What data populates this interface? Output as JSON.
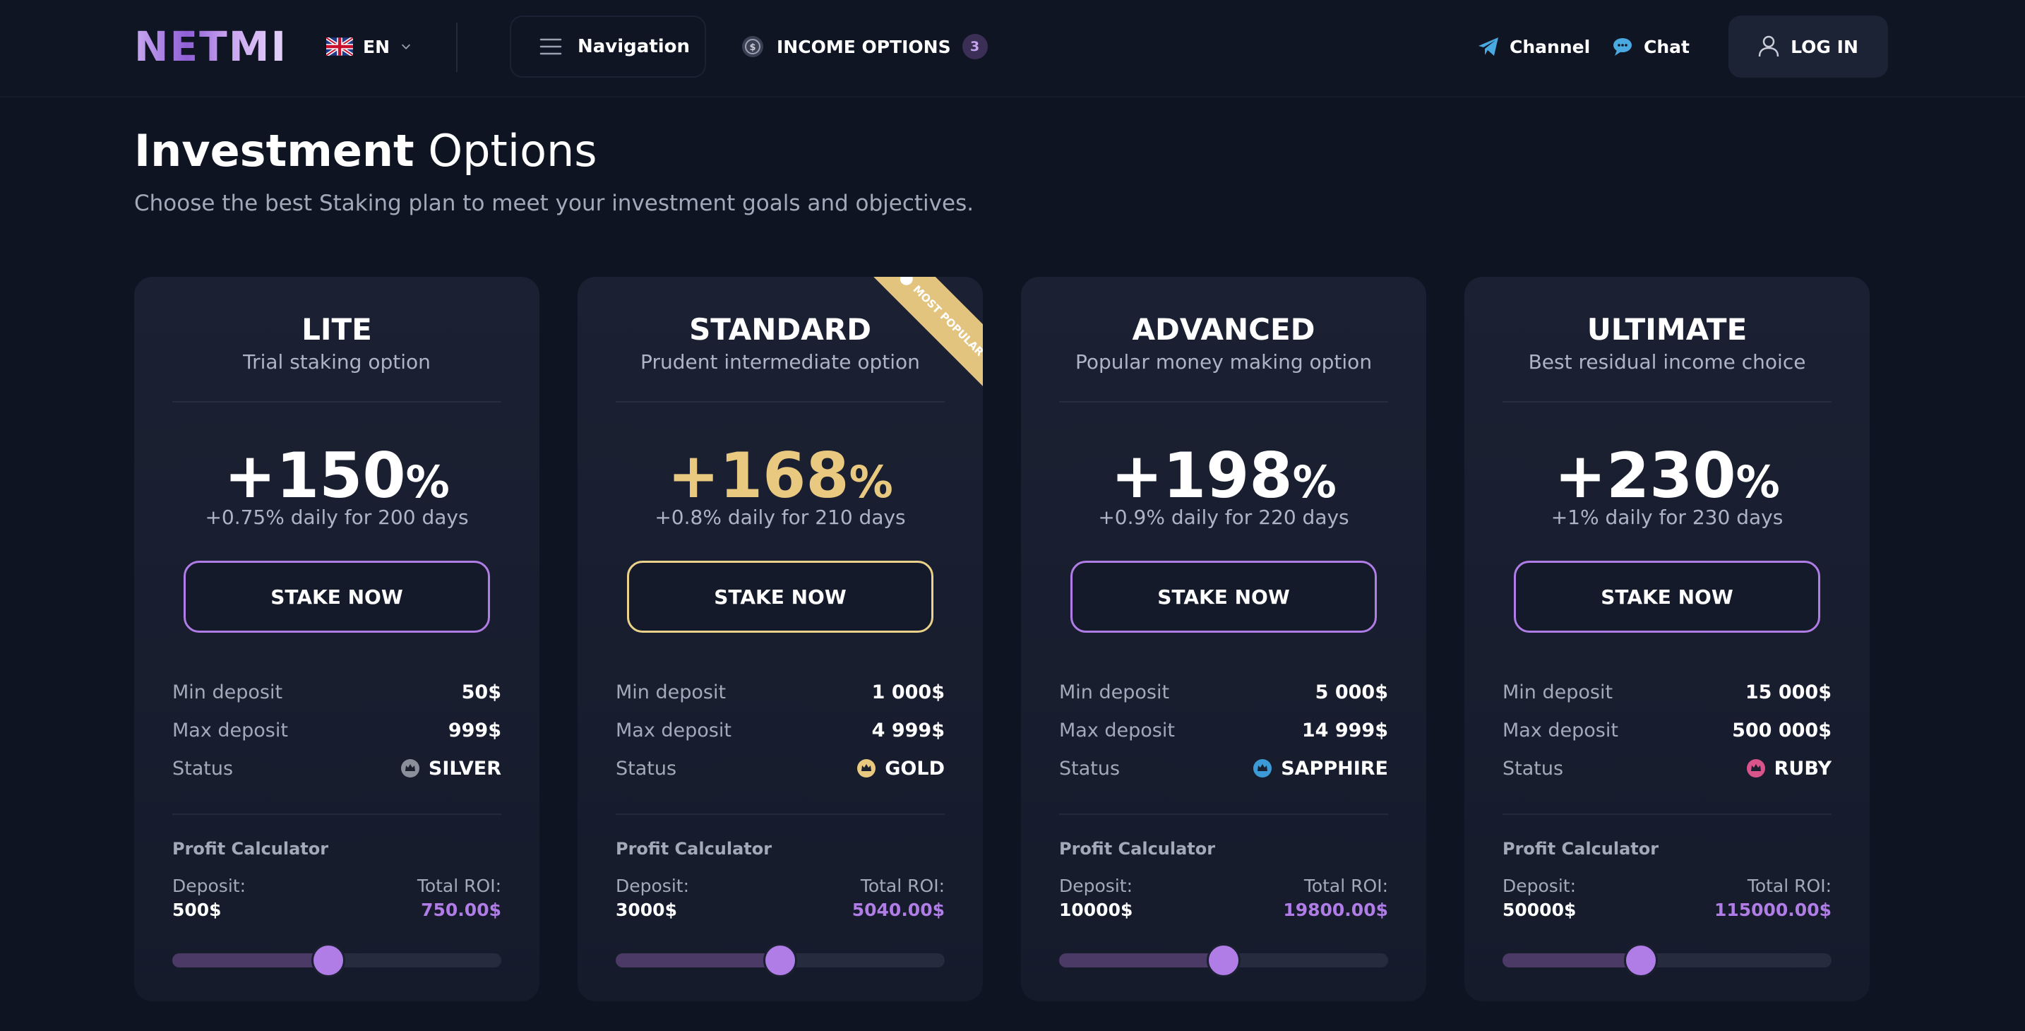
{
  "header": {
    "logo": "NETMI",
    "language": "EN",
    "nav_label": "Navigation",
    "income_label": "INCOME OPTIONS",
    "income_count": "3",
    "channel_label": "Channel",
    "chat_label": "Chat",
    "login_label": "LOG IN",
    "icons": [
      "uk-flag-icon",
      "chevron-down-icon",
      "menu-icon",
      "coin-icon",
      "telegram-icon",
      "chat-icon",
      "user-icon"
    ]
  },
  "title": {
    "bold": "Investment",
    "light": "Options",
    "subtitle": "Choose the best Staking plan to meet your investment goals and objectives."
  },
  "colors": {
    "accent_purple": "#b07ce6",
    "accent_gold": "#e8c97f",
    "status_silver": "#8b8f99",
    "status_gold": "#e8c97f",
    "status_sapphire": "#3c9bd6",
    "status_ruby": "#d9548b"
  },
  "labels": {
    "min_deposit": "Min deposit",
    "max_deposit": "Max deposit",
    "status": "Status",
    "profit_calculator": "Profit Calculator",
    "deposit": "Deposit:",
    "total_roi": "Total ROI:",
    "stake_now": "STAKE NOW",
    "most_popular": "MOST POPULAR",
    "percent_sign": "%"
  },
  "plans": [
    {
      "name": "LITE",
      "description": "Trial staking option",
      "roi": "+150",
      "daily": "+0.75% daily for 200 days",
      "min_deposit": "50$",
      "max_deposit": "999$",
      "status": "SILVER",
      "calc_deposit": "500$",
      "calc_roi": "750.00$",
      "slider_fraction": 0.475
    },
    {
      "name": "STANDARD",
      "description": "Prudent intermediate option",
      "roi": "+168",
      "daily": "+0.8% daily for 210 days",
      "min_deposit": "1 000$",
      "max_deposit": "4 999$",
      "status": "GOLD",
      "calc_deposit": "3000$",
      "calc_roi": "5040.00$",
      "slider_fraction": 0.5,
      "most_popular": true
    },
    {
      "name": "ADVANCED",
      "description": "Popular money making option",
      "roi": "+198",
      "daily": "+0.9% daily for 220 days",
      "min_deposit": "5 000$",
      "max_deposit": "14 999$",
      "status": "SAPPHIRE",
      "calc_deposit": "10000$",
      "calc_roi": "19800.00$",
      "slider_fraction": 0.5
    },
    {
      "name": "ULTIMATE",
      "description": "Best residual income choice",
      "roi": "+230",
      "daily": "+1% daily for 230 days",
      "min_deposit": "15 000$",
      "max_deposit": "500 000$",
      "status": "RUBY",
      "calc_deposit": "50000$",
      "calc_roi": "115000.00$",
      "slider_fraction": 0.42
    }
  ]
}
